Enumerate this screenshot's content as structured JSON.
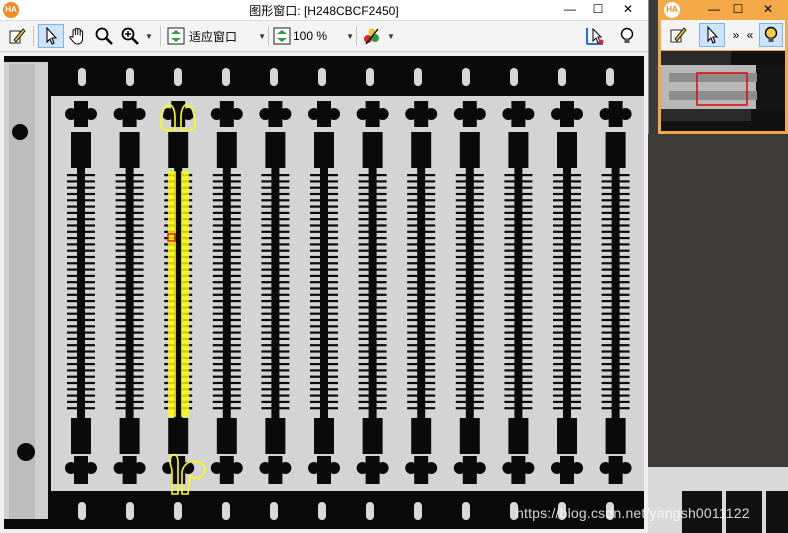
{
  "window": {
    "title": "图形窗口: [H248CBCF2450]",
    "logo_text": "HA",
    "minimize": "—",
    "maximize": "☐",
    "close": "✕"
  },
  "toolbar": {
    "fit_label": "适应窗口",
    "zoom_label": "100 %"
  },
  "aux_window": {
    "logo_text": "HA",
    "minimize": "—",
    "maximize": "☐",
    "close": "✕",
    "expand_right": "»",
    "expand_left": "«"
  },
  "watermark": "https://blog.csdn.net/yangsh0011122",
  "colors": {
    "accent_orange": "#f3a948",
    "selection_yellow": "#ffff00",
    "roi_red": "#e01010",
    "tool_selected": "#cce4f7"
  },
  "icons": [
    "edit-icon",
    "pointer-icon",
    "hand-icon",
    "magnifier-icon",
    "zoom-in-icon",
    "fit-window-icon",
    "zoom-percent-icon",
    "color-icon",
    "region-icon",
    "lightbulb-icon"
  ]
}
